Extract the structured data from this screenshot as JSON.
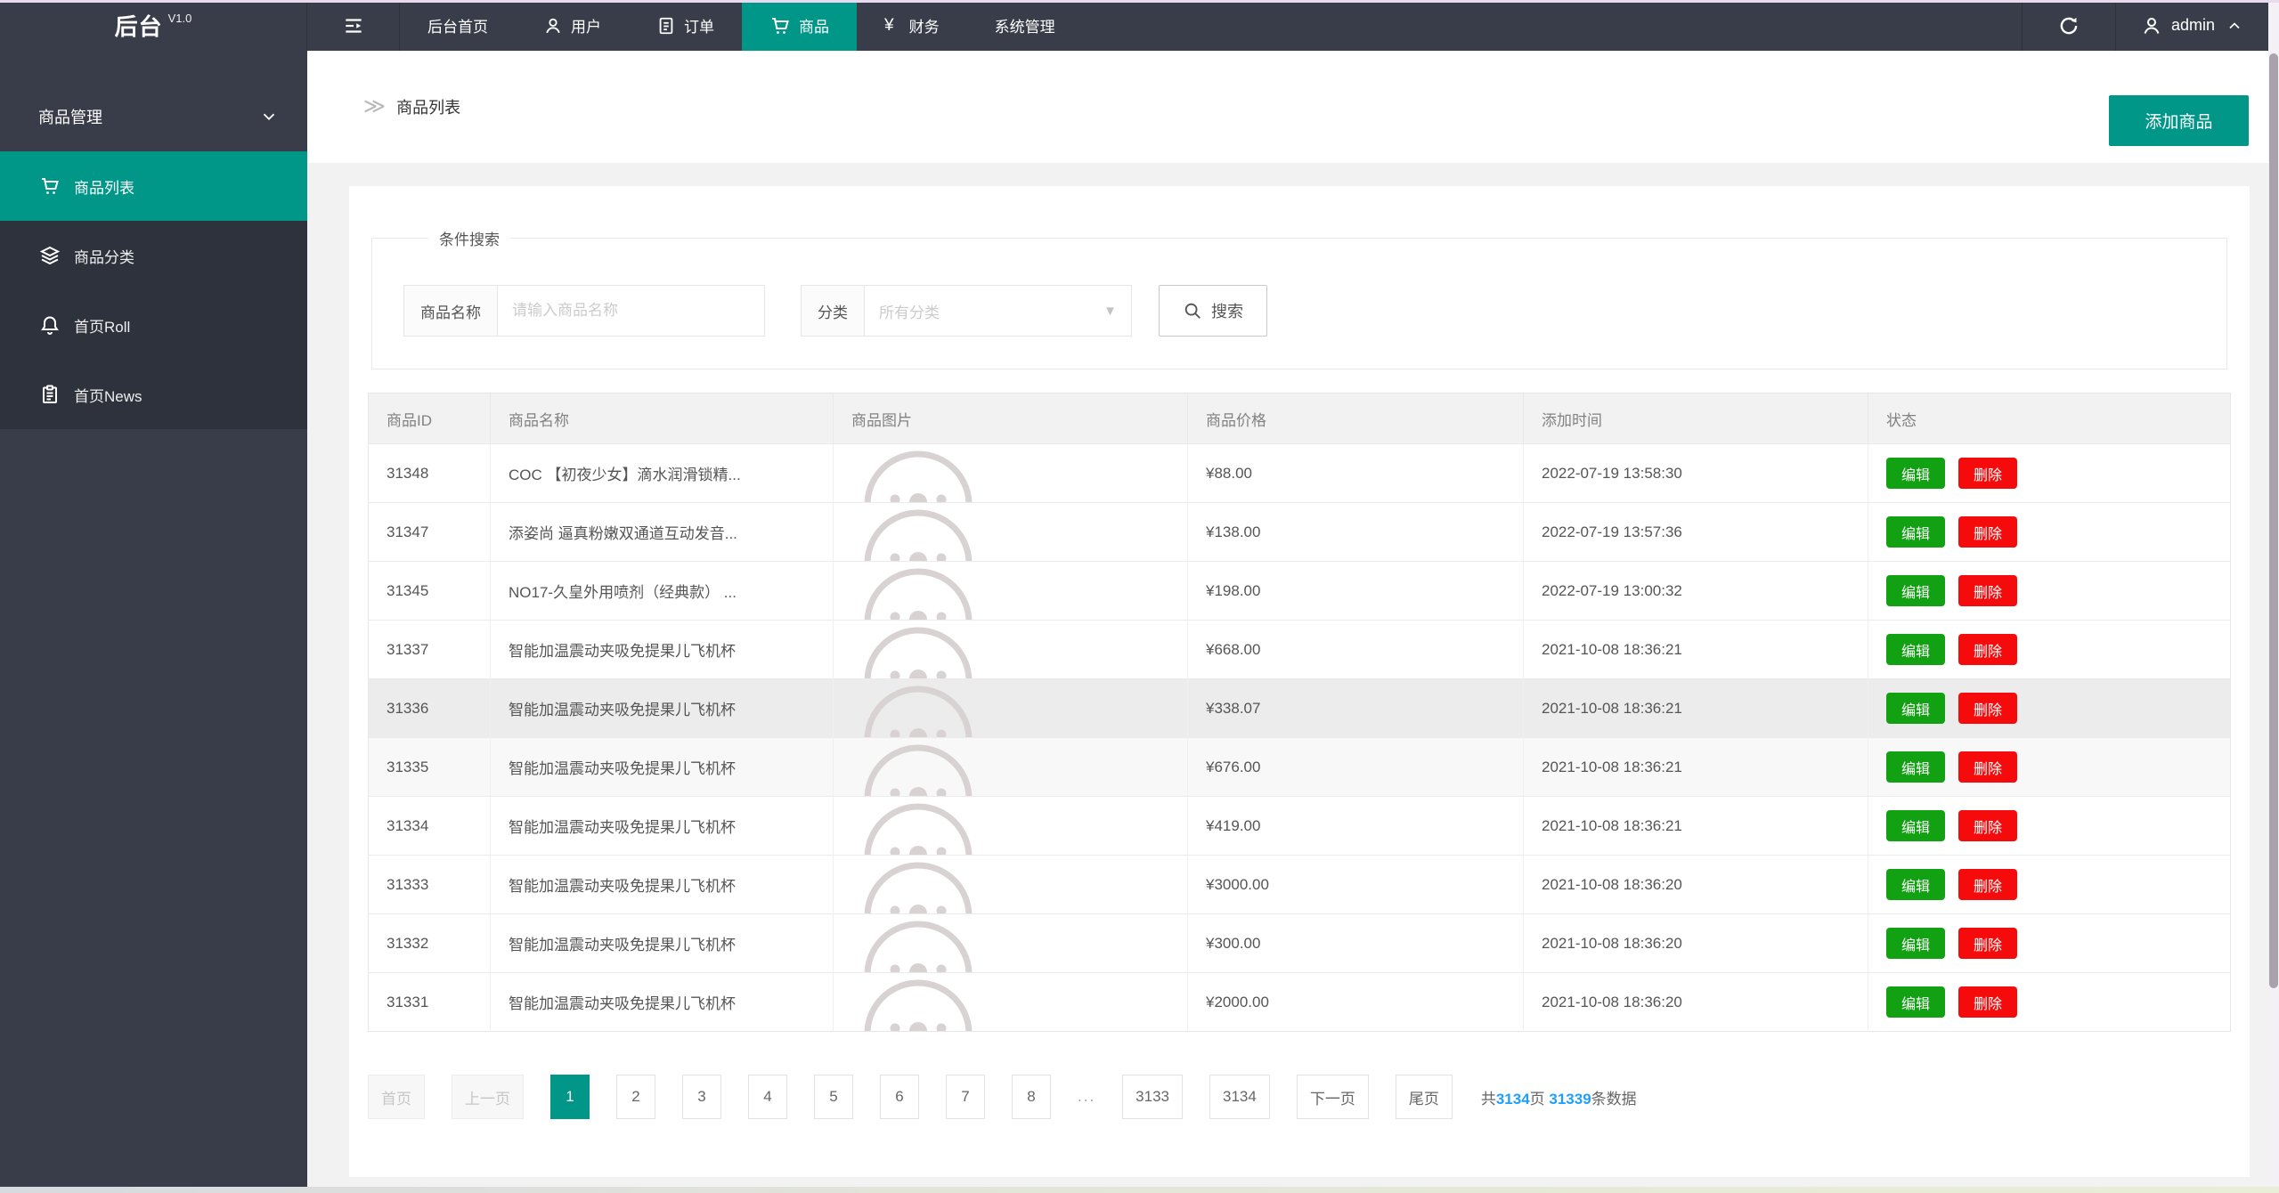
{
  "navbar": {
    "logo": "后台",
    "version": "V1.0",
    "items": [
      {
        "label": "后台首页",
        "icon": null,
        "active": false
      },
      {
        "label": "用户",
        "icon": "user",
        "active": false
      },
      {
        "label": "订单",
        "icon": "order",
        "active": false
      },
      {
        "label": "商品",
        "icon": "cart",
        "active": true
      },
      {
        "label": "财务",
        "icon": "yen",
        "active": false
      },
      {
        "label": "系统管理",
        "icon": null,
        "active": false
      }
    ],
    "username": "admin"
  },
  "sidebar": {
    "group_label": "商品管理",
    "items": [
      {
        "label": "商品列表",
        "icon": "cart",
        "active": true
      },
      {
        "label": "商品分类",
        "icon": "layers",
        "active": false
      },
      {
        "label": "首页Roll",
        "icon": "bell",
        "active": false
      },
      {
        "label": "首页News",
        "icon": "news",
        "active": false
      }
    ]
  },
  "breadcrumb": {
    "title": "商品列表"
  },
  "add_button_label": "添加商品",
  "search": {
    "legend": "条件搜索",
    "name_label": "商品名称",
    "name_placeholder": "请输入商品名称",
    "category_label": "分类",
    "category_value": "所有分类",
    "button_label": "搜索"
  },
  "table": {
    "columns": [
      "商品ID",
      "商品名称",
      "商品图片",
      "商品价格",
      "添加时间",
      "状态"
    ],
    "edit_label": "编辑",
    "delete_label": "删除",
    "rows": [
      {
        "id": "31348",
        "name": "COC 【初夜少女】滴水润滑锁精...",
        "price": "¥88.00",
        "time": "2022-07-19 13:58:30",
        "bg": "#ffffff"
      },
      {
        "id": "31347",
        "name": "添姿尚 逼真粉嫩双通道互动发音...",
        "price": "¥138.00",
        "time": "2022-07-19 13:57:36",
        "bg": "#ffffff"
      },
      {
        "id": "31345",
        "name": "NO17-久皇外用喷剂（经典款） ...",
        "price": "¥198.00",
        "time": "2022-07-19 13:00:32",
        "bg": "#ffffff"
      },
      {
        "id": "31337",
        "name": "智能加温震动夹吸免提果儿飞机杯",
        "price": "¥668.00",
        "time": "2021-10-08 18:36:21",
        "bg": "#ffffff"
      },
      {
        "id": "31336",
        "name": "智能加温震动夹吸免提果儿飞机杯",
        "price": "¥338.07",
        "time": "2021-10-08 18:36:21",
        "bg": "#ececec"
      },
      {
        "id": "31335",
        "name": "智能加温震动夹吸免提果儿飞机杯",
        "price": "¥676.00",
        "time": "2021-10-08 18:36:21",
        "bg": "#f8f8f8"
      },
      {
        "id": "31334",
        "name": "智能加温震动夹吸免提果儿飞机杯",
        "price": "¥419.00",
        "time": "2021-10-08 18:36:21",
        "bg": "#ffffff"
      },
      {
        "id": "31333",
        "name": "智能加温震动夹吸免提果儿飞机杯",
        "price": "¥3000.00",
        "time": "2021-10-08 18:36:20",
        "bg": "#ffffff"
      },
      {
        "id": "31332",
        "name": "智能加温震动夹吸免提果儿飞机杯",
        "price": "¥300.00",
        "time": "2021-10-08 18:36:20",
        "bg": "#ffffff"
      },
      {
        "id": "31331",
        "name": "智能加温震动夹吸免提果儿飞机杯",
        "price": "¥2000.00",
        "time": "2021-10-08 18:36:20",
        "bg": "#ffffff"
      }
    ]
  },
  "pagination": {
    "first_label": "首页",
    "prev_label": "上一页",
    "pages": [
      "1",
      "2",
      "3",
      "4",
      "5",
      "6",
      "7",
      "8",
      "...",
      "3133",
      "3134"
    ],
    "current_page": "1",
    "next_label": "下一页",
    "last_label": "尾页",
    "summary_prefix": "共",
    "total_pages": "3134",
    "pages_unit": "页",
    "total_records": "31339",
    "records_unit": "条数据"
  },
  "colors": {
    "accent_teal": "#009688",
    "navbar_dark": "#393d49",
    "submenu_dark": "#2e323c",
    "edit_green": "#12a112",
    "delete_red": "#f50b0b",
    "link_blue": "#1e9fff"
  }
}
